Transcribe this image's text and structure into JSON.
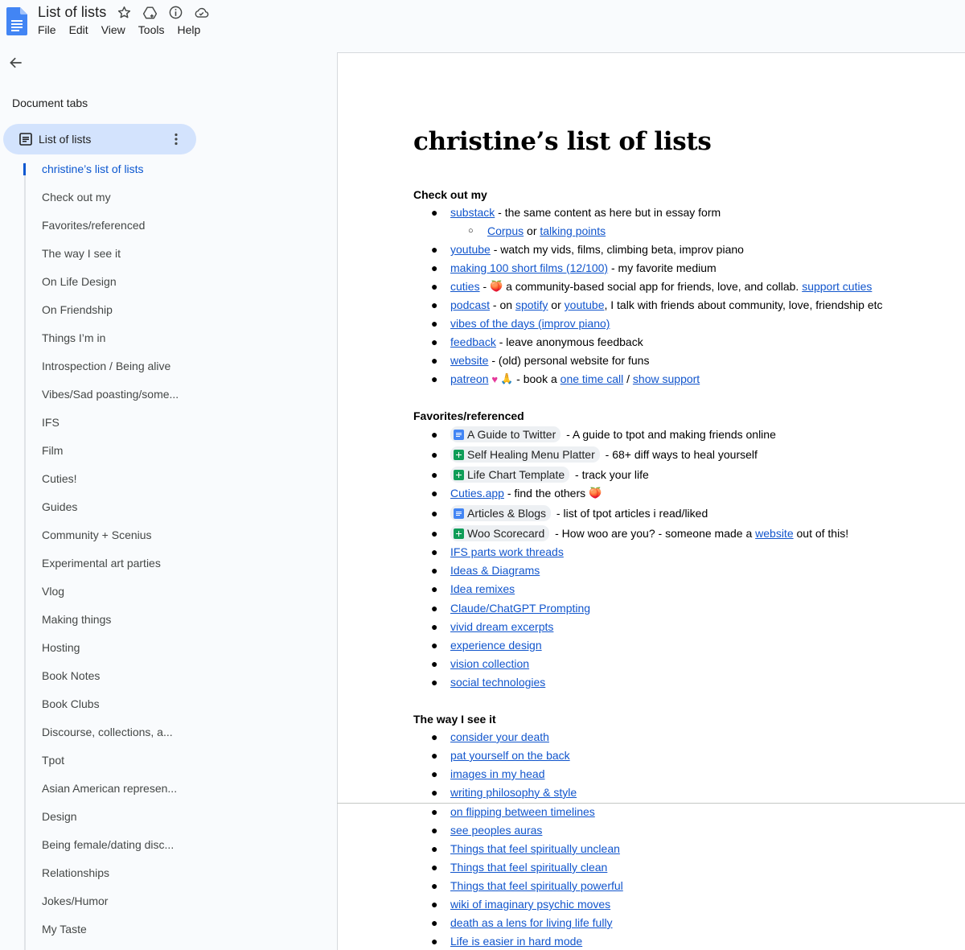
{
  "header": {
    "doc_title": "List of lists",
    "menu": [
      "File",
      "Edit",
      "View",
      "Tools",
      "Help"
    ]
  },
  "sidebar": {
    "heading": "Document tabs",
    "active_tab": "List of lists",
    "outline": [
      "christine’s list of lists",
      "Check out my",
      "Favorites/referenced",
      "The way I see it",
      "On Life Design",
      "On Friendship",
      "Things I’m in",
      "Introspection / Being alive",
      "Vibes/Sad poasting/some...",
      "IFS",
      "Film",
      "Cuties!",
      "Guides",
      "Community + Scenius",
      "Experimental art parties",
      "Vlog",
      "Making things",
      "Hosting",
      "Book Notes",
      "Book Clubs",
      "Discourse, collections, a...",
      "Tpot",
      "Asian American represen...",
      "Design",
      "Being female/dating disc...",
      "Relationships",
      "Jokes/Humor",
      "My Taste"
    ]
  },
  "doc": {
    "heading": "christine’s list of lists",
    "check_out": {
      "title": "Check out my",
      "substack": "substack",
      "substack_desc": " - the same content as here but in essay form",
      "corpus": "Corpus",
      "or": " or ",
      "talking_points": "talking points",
      "youtube": "youtube",
      "youtube_desc": " - watch my vids, films, climbing beta, improv piano",
      "films": "making 100 short films (12/100)",
      "films_desc": " - my favorite medium",
      "cuties": "cuties",
      "cuties_desc": " a community-based social app for friends, love, and collab. ",
      "support_cuties": "support cuties",
      "podcast": "podcast",
      "podcast_on": " - on ",
      "spotify": "spotify",
      "podcast_or": " or ",
      "youtube2": "youtube",
      "podcast_desc": ", I talk with friends about community, love, friendship etc",
      "vibes": "vibes of the days (improv piano)",
      "feedback": "feedback",
      "feedback_desc": " - leave anonymous feedback",
      "website": "website",
      "website_desc": " - (old) personal website for funs",
      "patreon": "patreon",
      "patreon_mid": " - book a ",
      "one_time_call": "one time call",
      "slash": " / ",
      "show_support": "show support"
    },
    "favorites": {
      "title": "Favorites/referenced",
      "twitter_chip": "A Guide to Twitter",
      "twitter_desc": " - A guide to tpot and making friends online",
      "healing_chip": "Self Healing Menu Platter",
      "healing_desc": " - 68+ diff ways to heal yourself",
      "lifechart_chip": "Life Chart Template",
      "lifechart_desc": " - track your life",
      "cutiesapp": "Cuties.app",
      "cutiesapp_desc": " - find the others ",
      "articles_chip": "Articles & Blogs",
      "articles_desc": " - list of tpot articles i read/liked",
      "woo_chip": "Woo Scorecard",
      "woo_desc": " - How woo are you? - someone made a ",
      "woo_website": "website",
      "woo_end": " out of this!",
      "links": [
        "IFS parts work threads",
        "Ideas & Diagrams",
        "Idea remixes",
        "Claude/ChatGPT Prompting",
        "vivid dream excerpts",
        "experience design",
        "vision collection",
        "social technologies"
      ]
    },
    "way_i_see": {
      "title": "The way I see it",
      "links": [
        "consider your death",
        "pat yourself on the back",
        "images in my head",
        "writing philosophy & style",
        "on flipping between timelines",
        "see peoples auras",
        "Things that feel spiritually unclean",
        "Things that feel spiritually clean",
        "Things that feel spiritually powerful",
        "wiki of imaginary psychic moves",
        "death as a lens for living life fully",
        "Life is easier in hard mode"
      ]
    }
  }
}
